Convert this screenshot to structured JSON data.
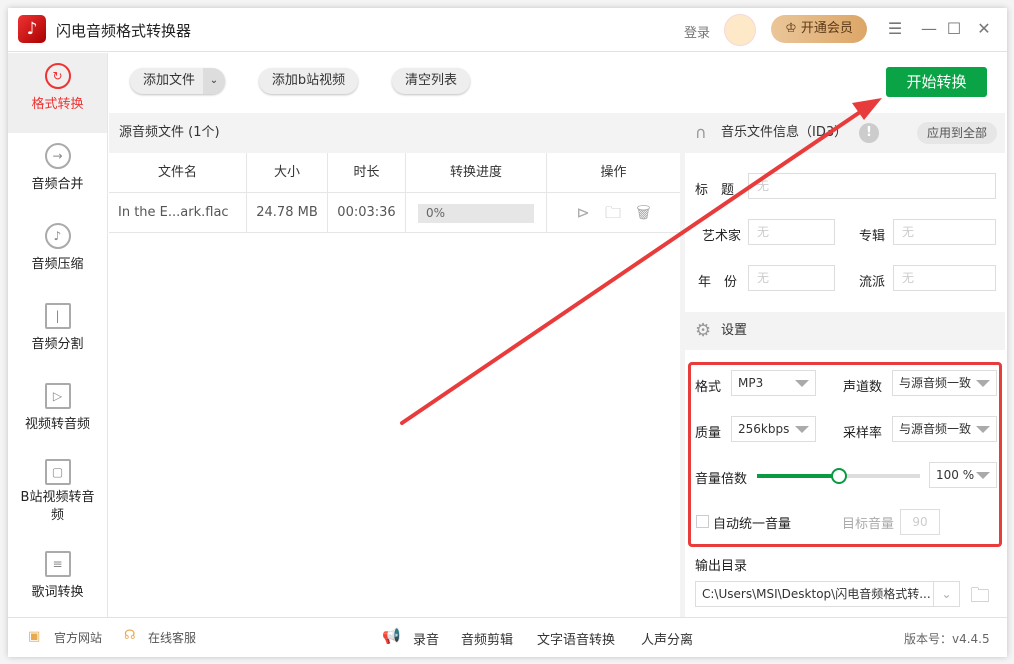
{
  "app": {
    "title": "闪电音频格式转换器",
    "login": "登录",
    "vip": "开通会员"
  },
  "sidebar": {
    "items": [
      {
        "label": "格式转换",
        "icon": "refresh-icon"
      },
      {
        "label": "音频合并",
        "icon": "merge-icon"
      },
      {
        "label": "音频压缩",
        "icon": "music-note-icon"
      },
      {
        "label": "音频分割",
        "icon": "split-icon"
      },
      {
        "label": "视频转音频",
        "icon": "video-audio-icon"
      },
      {
        "label": "B站视频转音频",
        "icon": "bilibili-icon"
      },
      {
        "label": "歌词转换",
        "icon": "lyrics-icon"
      }
    ]
  },
  "toolbar": {
    "add_file": "添加文件",
    "add_bilibili": "添加b站视频",
    "clear_list": "清空列表",
    "start": "开始转换"
  },
  "filelist": {
    "title": "源音频文件 (1个)",
    "columns": [
      "文件名",
      "大小",
      "时长",
      "转换进度",
      "操作"
    ],
    "rows": [
      {
        "name": "In the E...ark.flac",
        "size": "24.78 MB",
        "duration": "00:03:36",
        "progress": "0%"
      }
    ]
  },
  "id3": {
    "title": "音乐文件信息（ID3）",
    "apply_all": "应用到全部",
    "fields": {
      "title_label": "标　题",
      "artist_label": "艺术家",
      "album_label": "专辑",
      "year_label": "年　份",
      "genre_label": "流派",
      "placeholder": "无"
    }
  },
  "settings": {
    "title": "设置",
    "format_label": "格式",
    "format": "MP3",
    "channels_label": "声道数",
    "channels": "与源音频一致",
    "quality_label": "质量",
    "quality": "256kbps",
    "samplerate_label": "采样率",
    "samplerate": "与源音频一致",
    "volume_label": "音量倍数",
    "volume": "100",
    "volume_unit": "%",
    "volume_percent": 50,
    "auto_label": "自动统一音量",
    "target_label": "目标音量",
    "target": "90"
  },
  "output": {
    "label": "输出目录",
    "path": "C:\\Users\\MSI\\Desktop\\闪电音频格式转..."
  },
  "footer": {
    "website": "官方网站",
    "support": "在线客服",
    "record": "录音",
    "edit": "音频剪辑",
    "tts": "文字语音转换",
    "separate": "人声分离",
    "version": "版本号：v4.4.5"
  },
  "colors": {
    "accent": "#0aa345",
    "active": "#e33333",
    "annotation": "#e83b3b"
  }
}
